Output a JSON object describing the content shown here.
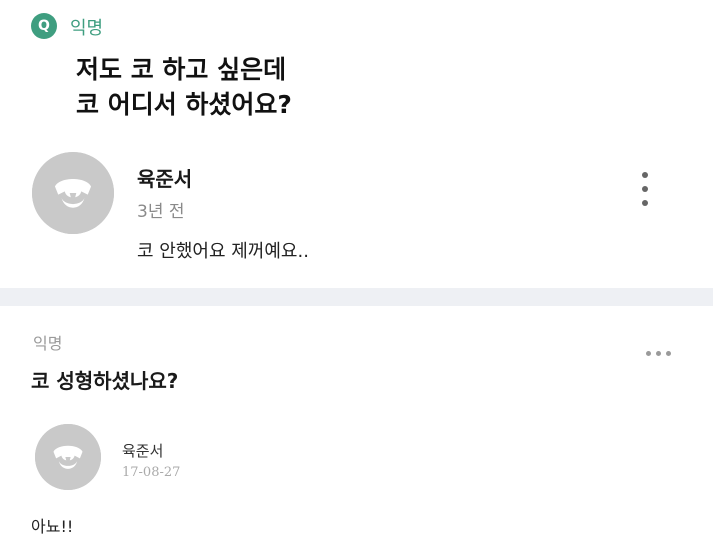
{
  "question": {
    "badge": "Q",
    "author": "익명",
    "title_lines": [
      "저도 코 하고 싶은데",
      "코 어디서 하셨어요?"
    ]
  },
  "answer": {
    "author": "육준서",
    "time": "3년 전",
    "body": "코 안했어요 제꺼예요..",
    "avatar_icon": "default-dog-avatar-icon",
    "menu_icon": "kebab-menu-icon"
  },
  "post": {
    "author": "익명",
    "title": "코 성형하셨나요?",
    "menu_icon": "more-horizontal-icon"
  },
  "comment": {
    "author": "육준서",
    "date": "17-08-27",
    "body": "아뇨!!",
    "avatar_icon": "default-dog-avatar-icon"
  },
  "colors": {
    "accent_green": "#3f9e80",
    "avatar_bg": "#c9c9c9",
    "divider_bg": "#eef0f4"
  }
}
